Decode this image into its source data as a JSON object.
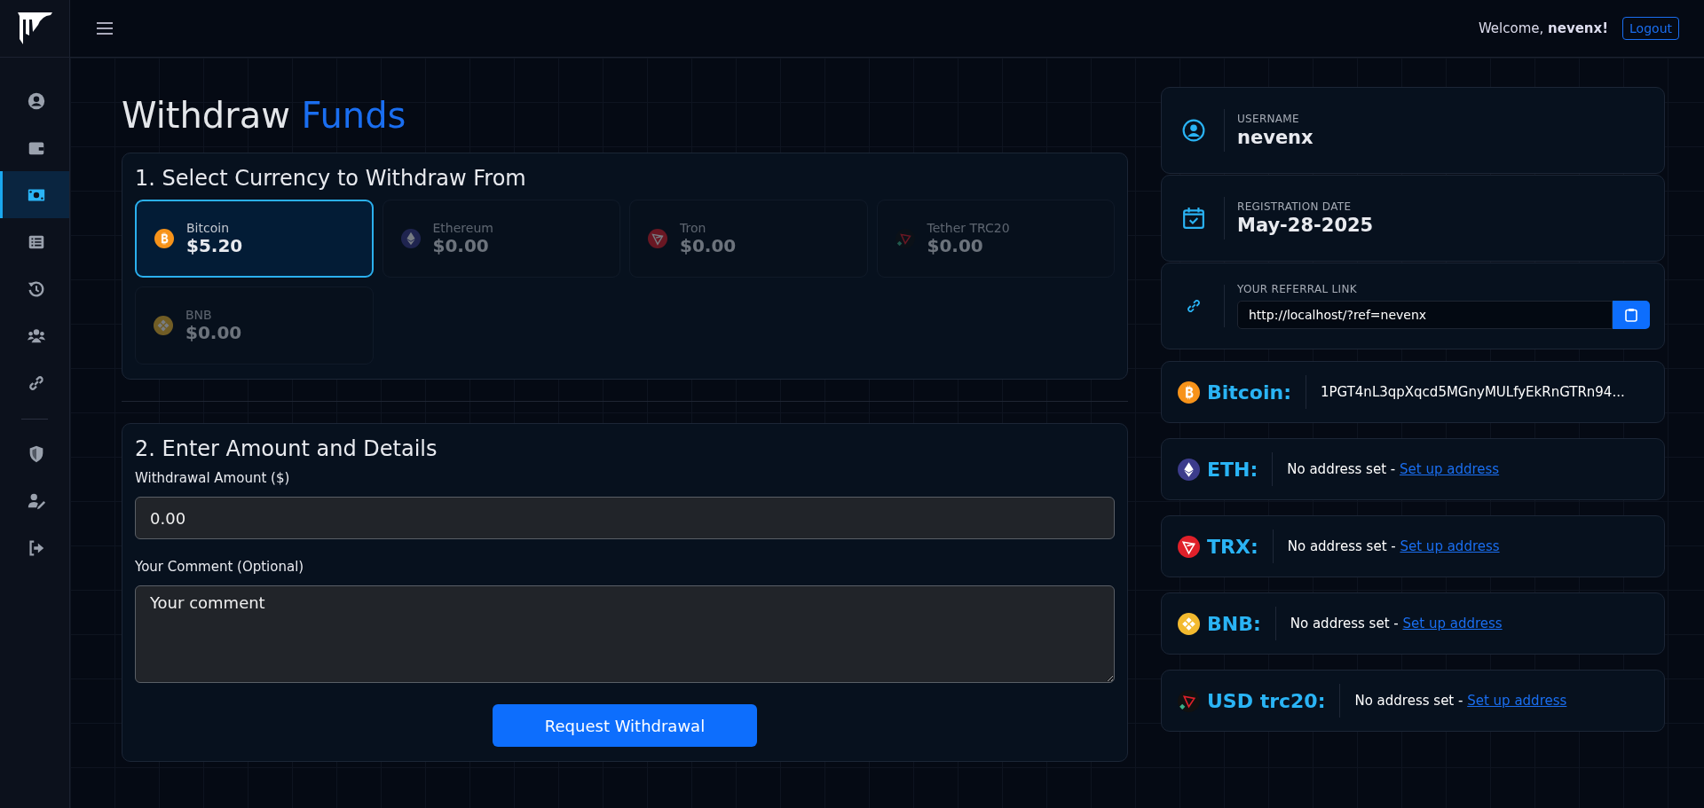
{
  "sidebar": {
    "groups": [
      {
        "items": [
          {
            "selected": false
          },
          {
            "selected": false
          },
          {
            "selected": true
          },
          {
            "selected": false
          },
          {
            "selected": false
          },
          {
            "selected": false
          },
          {
            "selected": false
          }
        ]
      },
      {
        "items": [
          {
            "selected": false
          },
          {
            "selected": false
          },
          {
            "selected": false
          }
        ]
      }
    ]
  },
  "header": {
    "welcome": "Welcome, **nevenx!**",
    "logout": "Logout"
  },
  "page_title": {
    "text": "Withdraw",
    "accent": "Funds"
  },
  "currency_section": {
    "title": "1. Select Currency to Withdraw From",
    "currencies": [
      {
        "kind": "btc",
        "name": "Bitcoin",
        "balance": "$5.20",
        "selected": true,
        "disabled": false
      },
      {
        "kind": "eth",
        "name": "Ethereum",
        "balance": "$0.00",
        "selected": false,
        "disabled": true
      },
      {
        "kind": "trx",
        "name": "Tron",
        "balance": "$0.00",
        "selected": false,
        "disabled": true
      },
      {
        "kind": "usdt",
        "name": "Tether TRC20",
        "balance": "$0.00",
        "selected": false,
        "disabled": true
      },
      {
        "kind": "bnb",
        "name": "BNB",
        "balance": "$0.00",
        "selected": false,
        "disabled": true
      }
    ]
  },
  "details_section": {
    "title": "2. Enter Amount and Details",
    "amount_label": "Withdrawal Amount ($)",
    "amount_value": "0.00",
    "comment_label": "Your Comment (Optional)",
    "comment_placeholder": "Your comment",
    "submit": "Request Withdrawal"
  },
  "profile": {
    "username_label": "USERNAME",
    "username": "nevenx",
    "registration_label": "REGISTRATION DATE",
    "registration_date": "May-28-2025",
    "referral_label": "YOUR REFERRAL LINK",
    "referral_link": "http://localhost/?ref=nevenx"
  },
  "wallets": [
    {
      "kind": "btc",
      "label": "Bitcoin:",
      "address": "1PGT4nL3qpXqcd5MGnyMULfyEkRnGTRn94..."
    },
    {
      "kind": "eth",
      "label": "ETH:",
      "status": "No address set - ",
      "link": "Set up address"
    },
    {
      "kind": "trx",
      "label": "TRX:",
      "status": "No address set - ",
      "link": "Set up address"
    },
    {
      "kind": "bnb",
      "label": "BNB:",
      "status": "No address set - ",
      "link": "Set up address"
    },
    {
      "kind": "usdt",
      "label": "USD trc20:",
      "status": "No address set - ",
      "link": "Set up address"
    }
  ]
}
